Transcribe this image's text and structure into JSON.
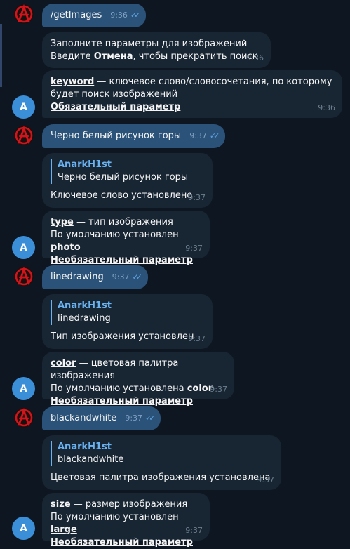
{
  "user_avatar": {
    "label": "Ⓐ"
  },
  "bot_avatar": {
    "letter": "A"
  },
  "messages": {
    "m1": {
      "text": "/getImages",
      "time": "9:36"
    },
    "m2": {
      "line1": "Заполните параметры для изображений",
      "line2_pre": " Введите ",
      "line2_bold": "Отмена",
      "line2_post": ", чтобы прекратить поиск",
      "time": "9:36"
    },
    "m3": {
      "key": "keyword",
      "desc": " — ключевое слово/словосочетания, по которому",
      "line2": "будет поиск изображений",
      "req": "Обязательный параметр",
      "time": "9:36"
    },
    "m4": {
      "text": "Черно белый рисунок горы",
      "time": "9:37"
    },
    "m5": {
      "author": "AnarkH1st",
      "quote": "Черно белый рисунок горы",
      "text": "Ключевое слово установлено",
      "time": "9:37"
    },
    "m6": {
      "key": "type",
      "desc": " — тип изображения",
      "default_pre": "По умолчанию установлен ",
      "default_val": "photo",
      "opt": "Необязательный параметр",
      "time": "9:37"
    },
    "m7": {
      "text": "linedrawing",
      "time": "9:37"
    },
    "m8": {
      "author": "AnarkH1st",
      "quote": "linedrawing",
      "text": "Тип изображения установлен",
      "time": "9:37"
    },
    "m9": {
      "key": "color",
      "desc": " — цветовая палитра изображения",
      "default_pre": "По умолчанию установлена ",
      "default_val": "color",
      "opt": "Необязательный параметр",
      "time": "9:37"
    },
    "m10": {
      "text": "blackandwhite",
      "time": "9:37"
    },
    "m11": {
      "author": "AnarkH1st",
      "quote": "blackandwhite",
      "text": "Цветовая палитра изображения установлена",
      "time": "9:37"
    },
    "m12": {
      "key": "size",
      "desc": " — размер изображения",
      "default_pre": "По умолчанию установлен ",
      "default_val": "large",
      "opt": "Необязательный параметр",
      "time": "9:37"
    }
  },
  "colors": {
    "background": "#0e1621",
    "user_bubble": "#2b5278",
    "bot_bubble": "#182533",
    "accent": "#6ab3f3",
    "avatar_bot": "#3b8fd9",
    "avatar_user": "#c0161b"
  }
}
